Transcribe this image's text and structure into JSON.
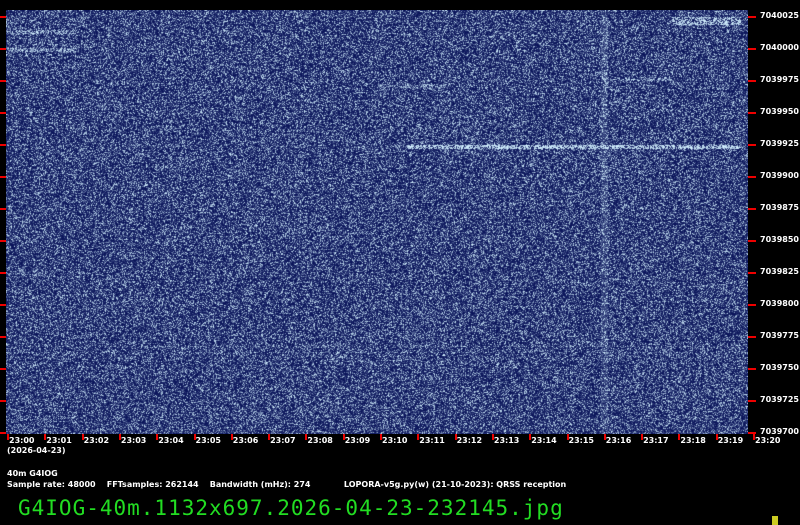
{
  "freq_labels": [
    "7040025",
    "7040000",
    "7039975",
    "7039950",
    "7039925",
    "7039900",
    "7039875",
    "7039850",
    "7039825",
    "7039800",
    "7039775",
    "7039750",
    "7039725",
    "7039700"
  ],
  "time_labels": [
    "23:00",
    "23:01",
    "23:02",
    "23:03",
    "23:04",
    "23:05",
    "23:06",
    "23:07",
    "23:08",
    "23:09",
    "23:10",
    "23:11",
    "23:12",
    "23:13",
    "23:14",
    "23:15",
    "23:16",
    "23:17",
    "23:18",
    "23:19",
    "23:20"
  ],
  "date_label": "(2026-04-23)",
  "station": "40m G4IOG",
  "info_line": "Sample rate: 48000    FFTsamples: 262144    Bandwidth (mHz): 274            LOPORA-v5g.py(w) (21-10-2023): QRSS reception",
  "filename": "G4IOG-40m.1132x697.2026-04-23-232145.jpg",
  "colors": {
    "background": "#000000",
    "waterfall": "#0a1a6a",
    "tick": "#ee0000",
    "filename": "#22dd22"
  }
}
